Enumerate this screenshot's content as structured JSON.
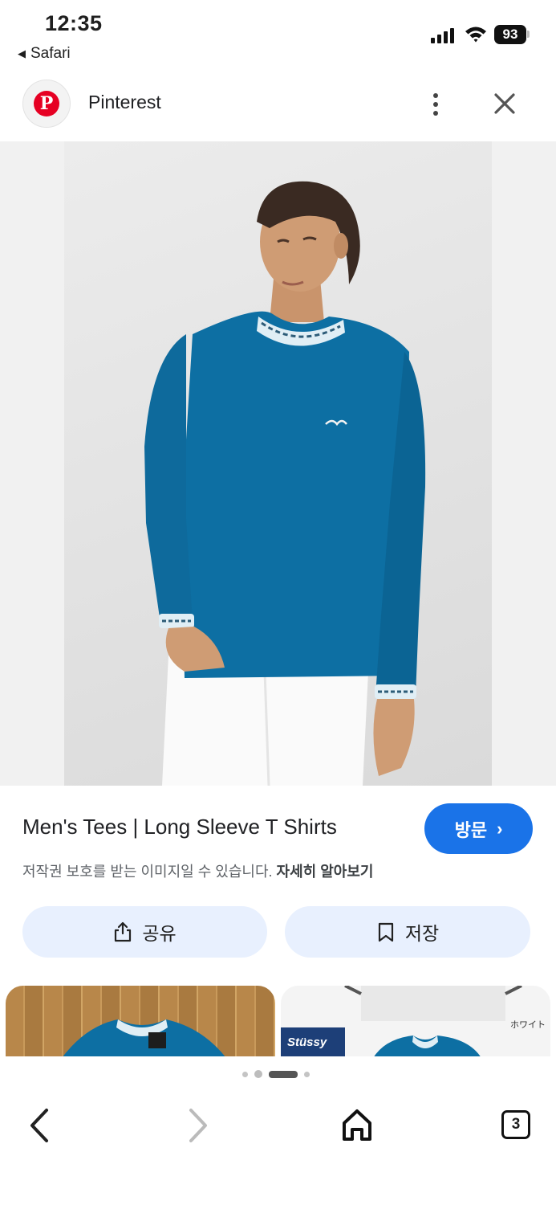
{
  "status_bar": {
    "time": "12:35",
    "back_app": "Safari",
    "battery": "93"
  },
  "header": {
    "site_name": "Pinterest",
    "logo_letter": "P",
    "icons": {
      "more": "more-vert-icon",
      "close": "close-icon"
    }
  },
  "result": {
    "title": "Men's Tees | Long Sleeve T Shirts",
    "visit_label": "방문",
    "copyright_text": "저작권 보호를 받는 이미지일 수 있습니다.",
    "learn_more": "자세히 알아보기",
    "share_label": "공유",
    "save_label": "저장"
  },
  "thumbnails": {
    "thumb2_caption": "ホワイト",
    "thumb2_brand": "Stüssy"
  },
  "carousel": {
    "page_count": 4,
    "active_index": 2
  },
  "bottom_nav": {
    "tab_count": "3"
  },
  "colors": {
    "accent": "#1a73e8",
    "action_bg": "#e8f0fe",
    "pinterest_red": "#e60023",
    "shirt_blue": "#0d6fa3"
  }
}
